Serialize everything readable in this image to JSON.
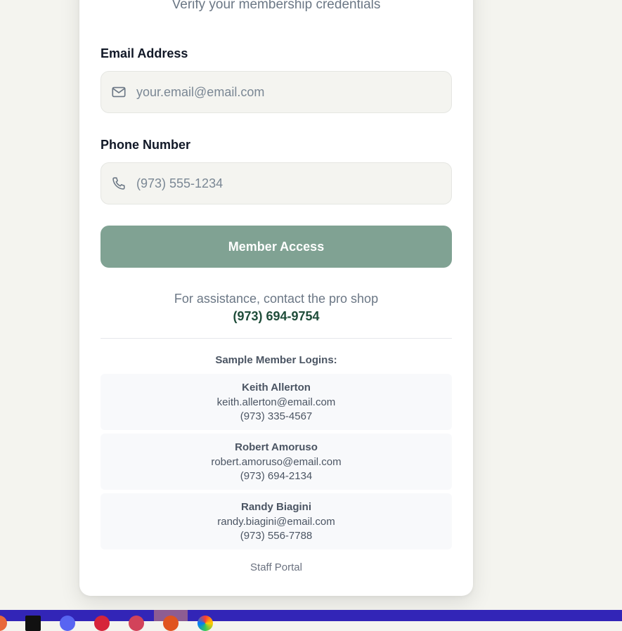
{
  "card": {
    "subtitle": "Verify your membership credentials"
  },
  "form": {
    "email_label": "Email Address",
    "email_placeholder": "your.email@email.com",
    "email_icon": "mail-icon",
    "phone_label": "Phone Number",
    "phone_placeholder": "(973) 555-1234",
    "phone_icon": "phone-icon",
    "submit_label": "Member Access"
  },
  "assistance": {
    "text": "For assistance, contact the pro shop",
    "phone": "(973) 694-9754"
  },
  "samples": {
    "title": "Sample Member Logins:",
    "members": [
      {
        "name": "Keith Allerton",
        "email": "keith.allerton@email.com",
        "phone": "(973) 335-4567"
      },
      {
        "name": "Robert Amoruso",
        "email": "robert.amoruso@email.com",
        "phone": "(973) 694-2134"
      },
      {
        "name": "Randy Biagini",
        "email": "randy.biagini@email.com",
        "phone": "(973) 556-7788"
      }
    ]
  },
  "footer": {
    "staff_link": "Staff Portal"
  },
  "colors": {
    "page_bg": "#f4f4ef",
    "button_bg": "#80a293",
    "accent_phone": "#1f4d3a",
    "taskbar": "#3225b7"
  },
  "taskbar": {
    "icons": [
      "browser-icon",
      "epic-games-icon",
      "discord-icon",
      "red-app-icon",
      "pink-app-icon",
      "orange-app-icon",
      "color-wheel-icon"
    ]
  }
}
